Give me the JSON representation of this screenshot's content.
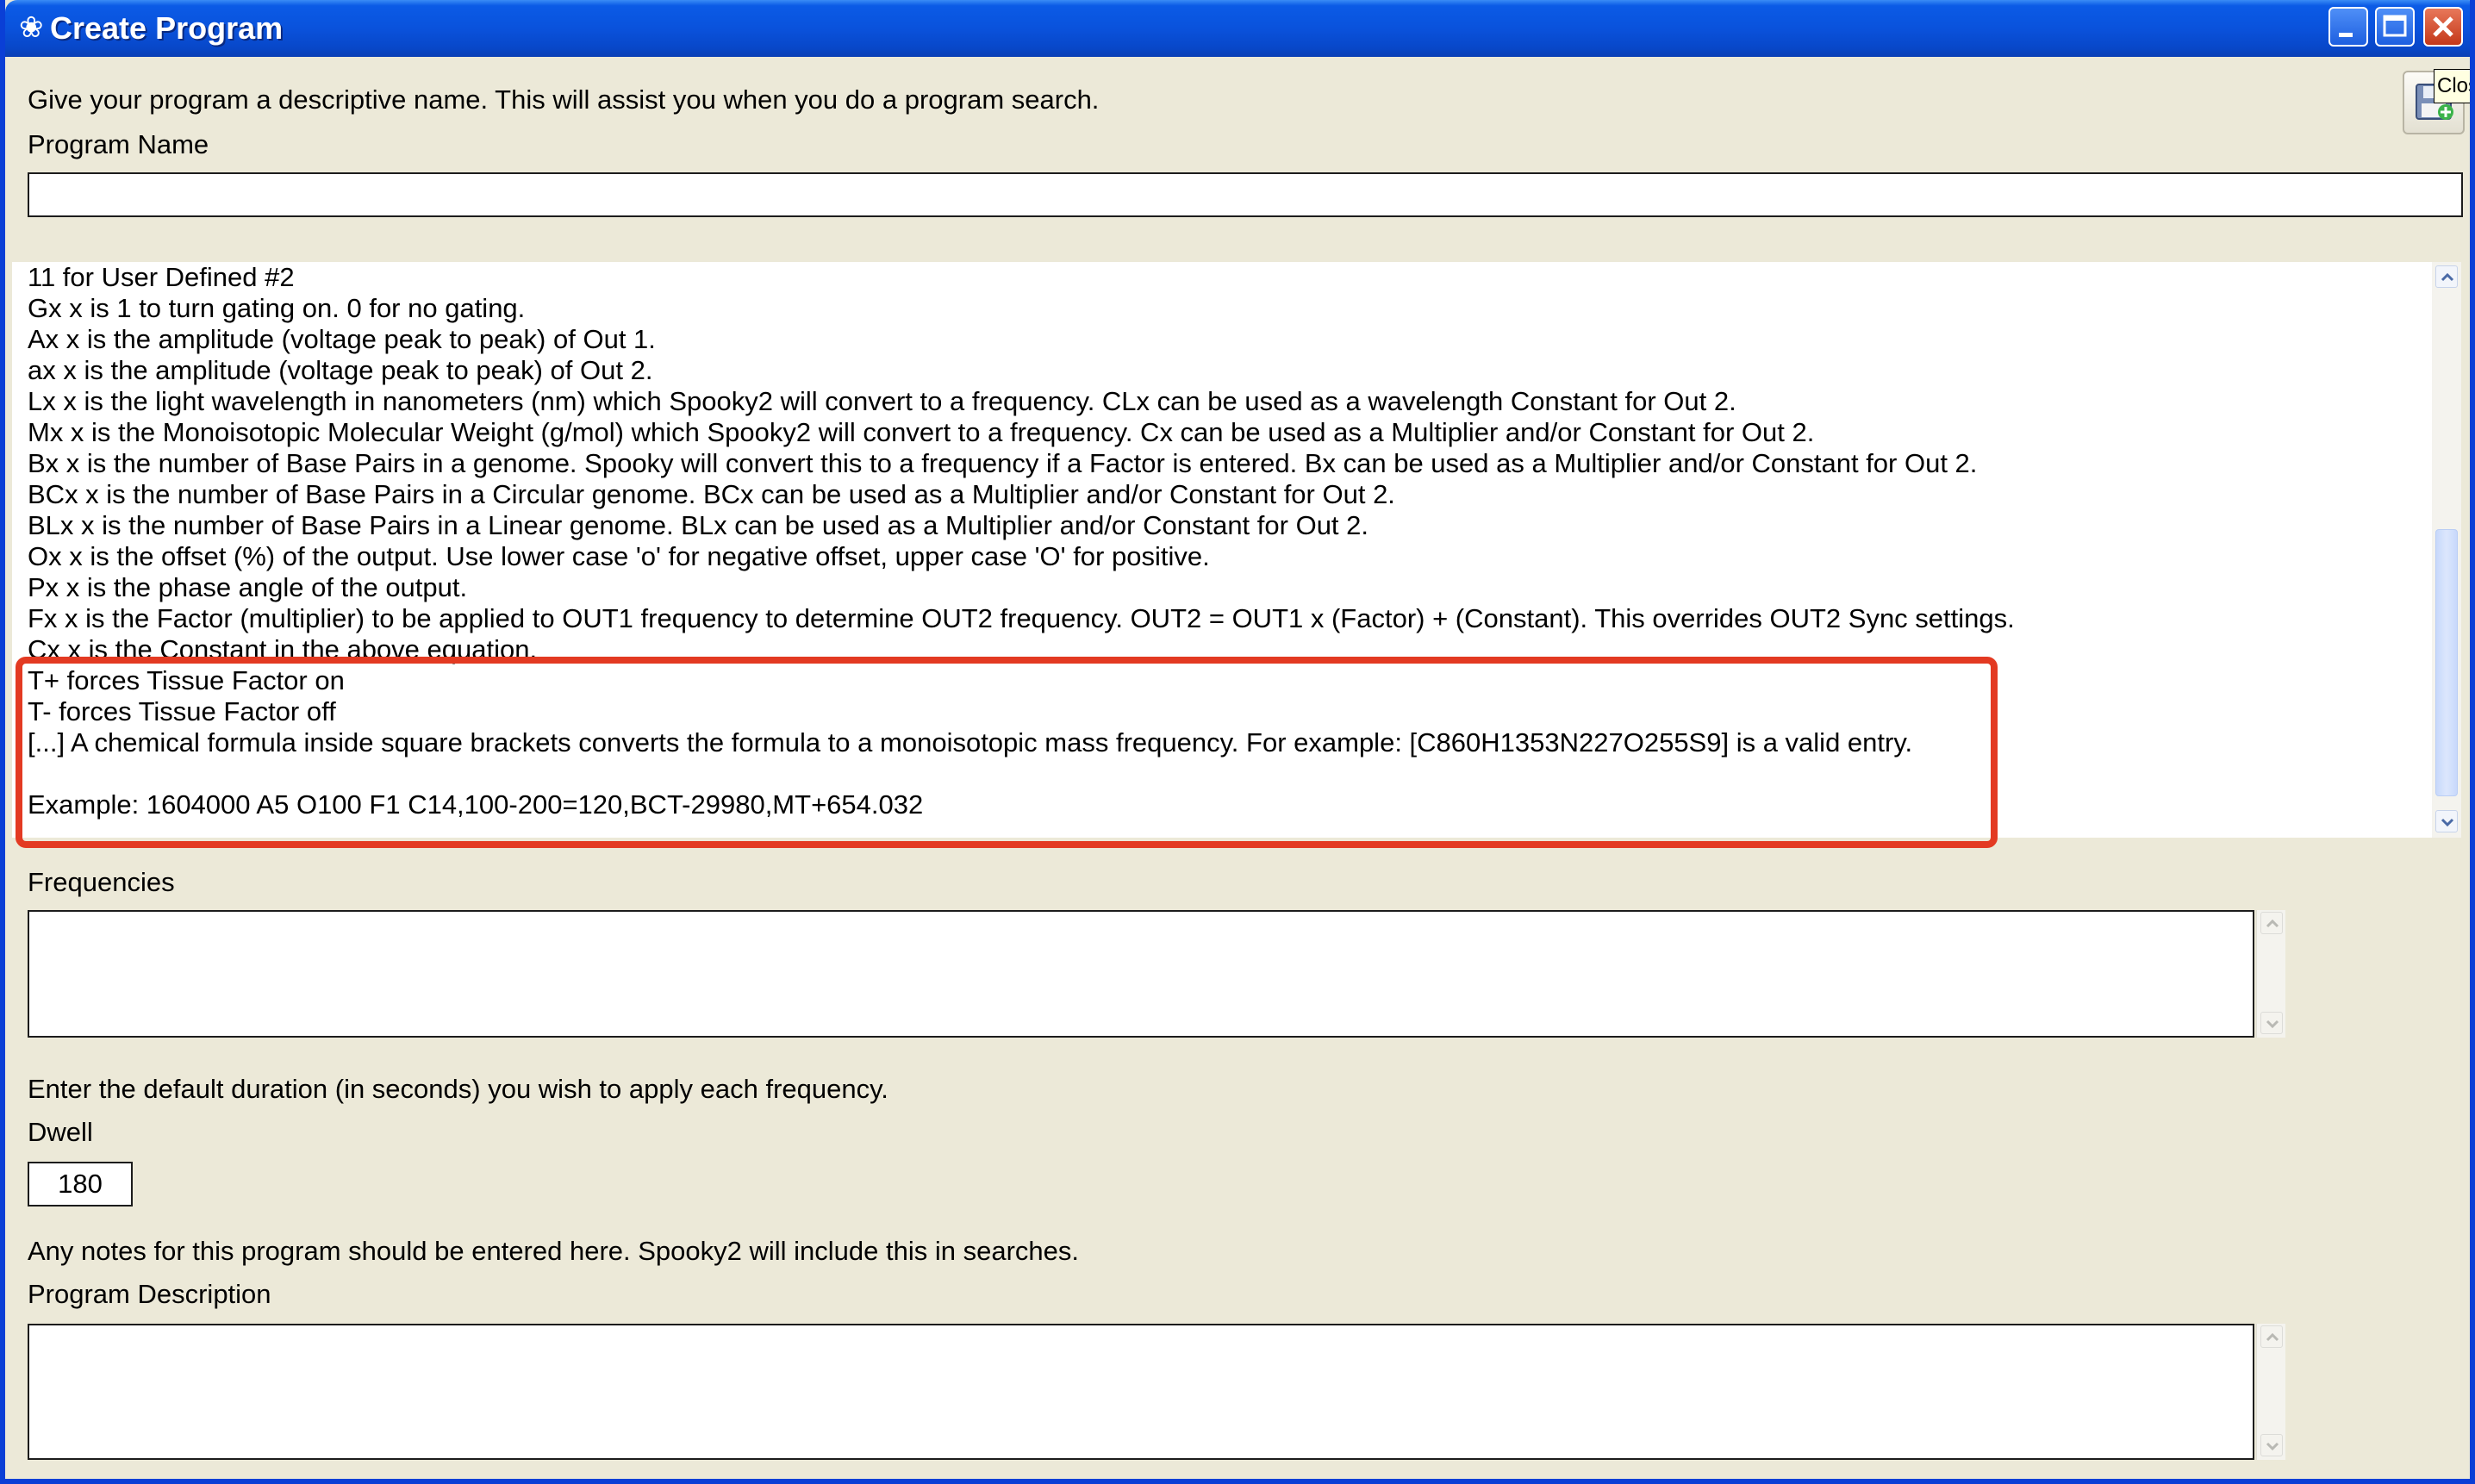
{
  "window": {
    "title": "Create Program",
    "tooltip": "Close"
  },
  "program_name": {
    "hint": "Give your program a descriptive name. This will assist you when you do a program search.",
    "label": "Program Name",
    "value": ""
  },
  "info_lines": [
    "11 for User Defined #2",
    "Gx  x is 1 to turn gating on. 0 for no gating.",
    "Ax  x is the amplitude (voltage peak to peak) of Out 1.",
    "ax  x is the amplitude (voltage peak to peak) of Out 2.",
    "Lx  x is the light wavelength in nanometers (nm) which Spooky2 will convert to a frequency. CLx can be used as a wavelength Constant for Out 2.",
    "Mx  x is the Monoisotopic Molecular Weight (g/mol) which Spooky2 will convert to a frequency. Cx can be used as a Multiplier and/or Constant for Out 2.",
    "Bx  x is the number of Base Pairs in a genome. Spooky will convert this to a frequency if a Factor is entered. Bx can be used as a Multiplier and/or Constant for Out 2.",
    "BCx x is the number of Base Pairs in a Circular genome. BCx can be used as a Multiplier and/or Constant for Out 2.",
    "BLx x is the number of Base Pairs in a Linear genome. BLx can be used as a Multiplier and/or Constant for Out 2.",
    "Ox  x is the offset (%) of the output. Use lower case 'o' for negative offset, upper case 'O' for positive.",
    "Px  x is the phase angle of the output.",
    "Fx  x is the Factor (multiplier) to be applied to OUT1 frequency to determine OUT2 frequency. OUT2 = OUT1 x (Factor) + (Constant). This overrides OUT2 Sync settings.",
    "Cx  x is the Constant in the above equation.",
    "T+ forces Tissue Factor on",
    "T- forces Tissue Factor off",
    "[...] A chemical formula inside square brackets converts the formula to a monoisotopic mass frequency. For example: [C860H1353N227O255S9] is a valid entry.",
    "",
    "Example: 1604000 A5 O100 F1 C14,100-200=120,BCT-29980,MT+654.032"
  ],
  "frequencies": {
    "label": "Frequencies",
    "value": ""
  },
  "dwell": {
    "hint": "Enter the default duration (in seconds) you wish to apply each frequency.",
    "label": "Dwell",
    "value": "180"
  },
  "description": {
    "hint": "Any notes for this program should be entered here. Spooky2 will include this in searches.",
    "label": "Program Description",
    "value": ""
  },
  "colors": {
    "title_bar": "#0a52dc",
    "dialog_bg": "#ECE9D8",
    "highlight": "#e33a22"
  }
}
